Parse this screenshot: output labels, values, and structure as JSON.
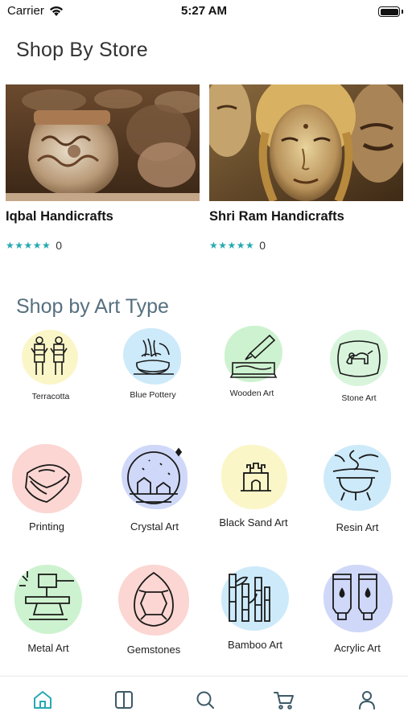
{
  "status": {
    "carrier": "Carrier",
    "time": "5:27 AM"
  },
  "stores": {
    "title": "Shop By Store",
    "items": [
      {
        "name": "Iqbal Handicrafts",
        "stars": "★★★★★",
        "rating": "0"
      },
      {
        "name": "Shri Ram Handicrafts",
        "stars": "★★★★★",
        "rating": "0"
      }
    ]
  },
  "art_types": {
    "title": "Shop by Art Type",
    "items": [
      {
        "label": "Terracotta",
        "icon": "terracotta-icon",
        "color": "#fbf6c8"
      },
      {
        "label": "Blue Pottery",
        "icon": "blue-pottery-icon",
        "color": "#cdeafa"
      },
      {
        "label": "Wooden Art",
        "icon": "wooden-art-icon",
        "color": "#cdf2cf"
      },
      {
        "label": "Stone Art",
        "icon": "stone-art-icon",
        "color": "#d8f5dc"
      },
      {
        "label": "Printing",
        "icon": "printing-icon",
        "color": "#fbd6d2"
      },
      {
        "label": "Crystal Art",
        "icon": "crystal-art-icon",
        "color": "#cfd8f8"
      },
      {
        "label": "Black Sand Art",
        "icon": "black-sand-art-icon",
        "color": "#fbf6c8"
      },
      {
        "label": "Resin Art",
        "icon": "resin-art-icon",
        "color": "#cdeafa"
      },
      {
        "label": "Metal Art",
        "icon": "metal-art-icon",
        "color": "#cdf2cf"
      },
      {
        "label": "Gemstones",
        "icon": "gemstones-icon",
        "color": "#fbd6d2"
      },
      {
        "label": "Bamboo Art",
        "icon": "bamboo-art-icon",
        "color": "#cdeafa"
      },
      {
        "label": "Acrylic Art",
        "icon": "acrylic-art-icon",
        "color": "#cfd8f8"
      }
    ]
  },
  "tab_bar": {
    "accent": "#27a9b1",
    "items": [
      {
        "icon": "home-icon",
        "active": true
      },
      {
        "icon": "catalog-icon",
        "active": false
      },
      {
        "icon": "search-icon",
        "active": false
      },
      {
        "icon": "cart-icon",
        "active": false
      },
      {
        "icon": "profile-icon",
        "active": false
      }
    ]
  }
}
